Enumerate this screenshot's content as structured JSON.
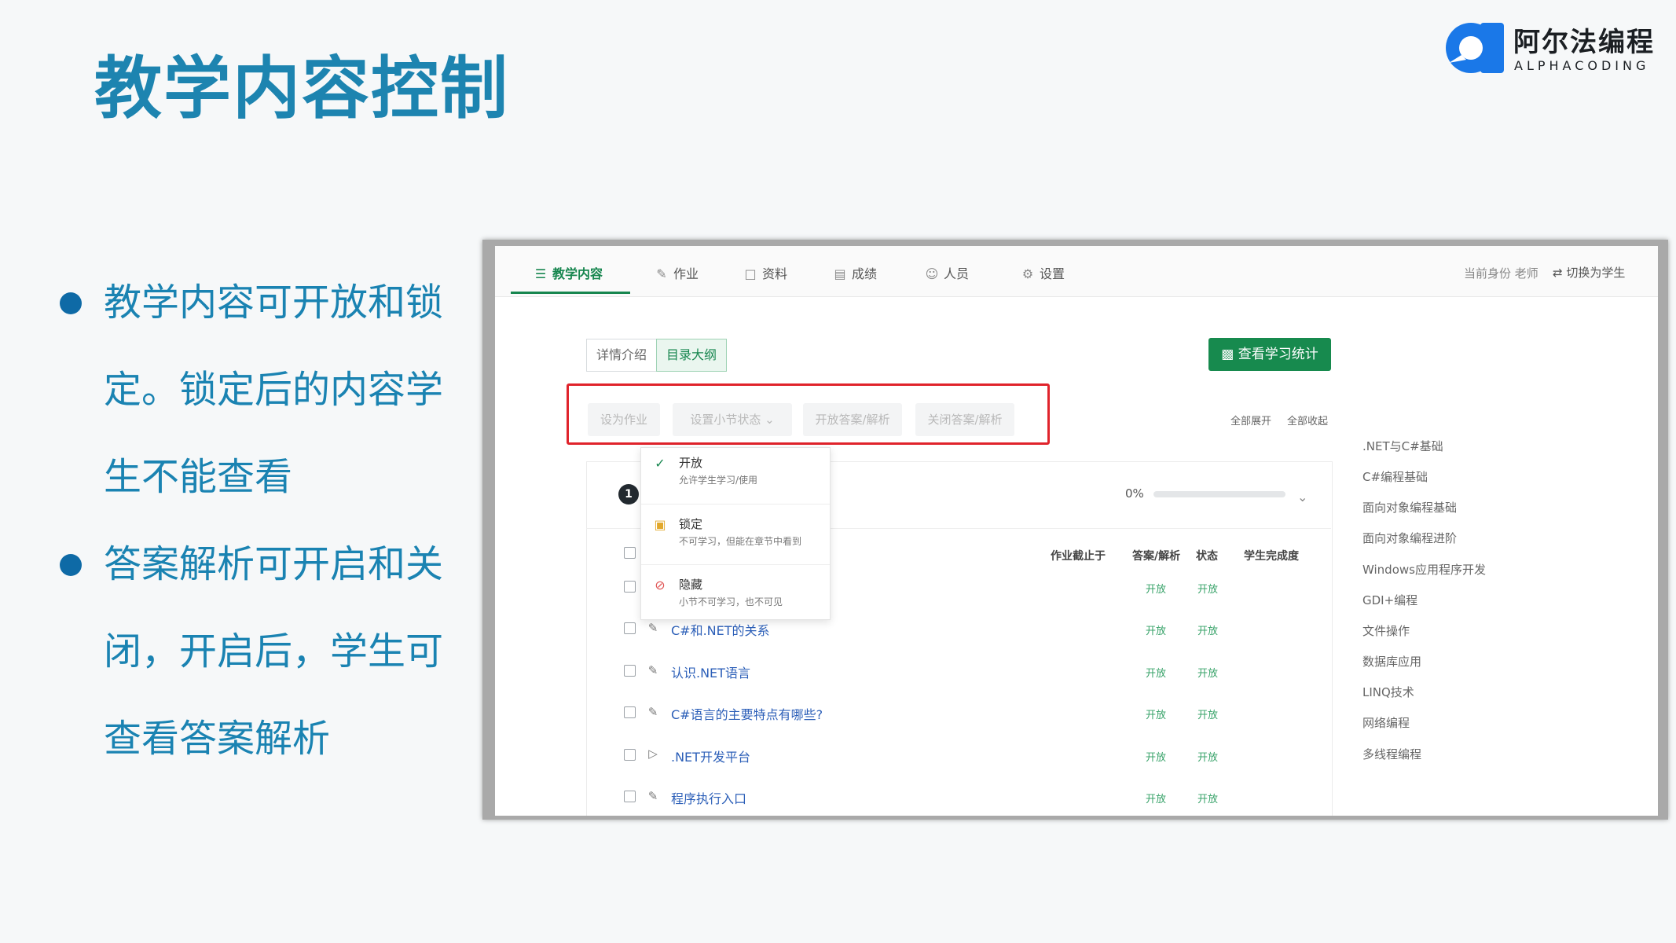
{
  "slide": {
    "title": "教学内容控制",
    "logo": {
      "cn": "阿尔法编程",
      "en": "ALPHACODING"
    },
    "bullets": [
      {
        "lines": [
          "教学内容可开放和锁",
          "定。锁定后的内容学",
          "生不能查看"
        ]
      },
      {
        "lines": [
          "答案解析可开启和关",
          "闭，开启后，学生可",
          "查看答案解析"
        ]
      }
    ]
  },
  "app": {
    "tabs": [
      {
        "label": "教学内容",
        "icon": "book-icon",
        "active": true
      },
      {
        "label": "作业",
        "icon": "pencil-icon"
      },
      {
        "label": "资料",
        "icon": "file-icon"
      },
      {
        "label": "成绩",
        "icon": "score-file-icon"
      },
      {
        "label": "人员",
        "icon": "people-icon"
      },
      {
        "label": "设置",
        "icon": "gear-icon"
      }
    ],
    "identity": "当前身份 老师",
    "switch_label": "切换为学生",
    "segments": [
      "详情介绍",
      "目录大纲"
    ],
    "stats_button": "查看学习统计",
    "toolbar": [
      "设为作业",
      "设置小节状态",
      "开放答案/解析",
      "关闭答案/解析"
    ],
    "expand_all": "全部展开",
    "collapse_all": "全部收起",
    "chapter": {
      "number": "1",
      "progress": "0%"
    },
    "columns": [
      "作业截止于",
      "答案/解析",
      "状态",
      "学生完成度"
    ],
    "rows": [
      {
        "title": "",
        "icon": "",
        "answer": "",
        "status": ""
      },
      {
        "title": "",
        "icon": "",
        "answer": "开放",
        "status": "开放"
      },
      {
        "title": "C#和.NET的关系",
        "icon": "pencil-icon",
        "answer": "开放",
        "status": "开放"
      },
      {
        "title": "认识.NET语言",
        "icon": "pencil-icon",
        "answer": "开放",
        "status": "开放"
      },
      {
        "title": "C#语言的主要特点有哪些?",
        "icon": "pencil-icon",
        "answer": "开放",
        "status": "开放"
      },
      {
        "title": ".NET开发平台",
        "icon": "video-icon",
        "answer": "开放",
        "status": "开放"
      },
      {
        "title": "程序执行入口",
        "icon": "pencil-icon",
        "answer": "开放",
        "status": "开放"
      }
    ],
    "dropdown": [
      {
        "label": "开放",
        "desc": "允许学生学习/使用",
        "icon": "check-icon"
      },
      {
        "label": "锁定",
        "desc": "不可学习，但能在章节中看到",
        "icon": "lock-icon"
      },
      {
        "label": "隐藏",
        "desc": "小节不可学习，也不可见",
        "icon": "eye-off-icon"
      }
    ],
    "sidebar": [
      ".NET与C#基础",
      "C#编程基础",
      "面向对象编程基础",
      "面向对象编程进阶",
      "Windows应用程序开发",
      "GDI+编程",
      "文件操作",
      "数据库应用",
      "LINQ技术",
      "网络编程",
      "多线程编程"
    ],
    "colors": {
      "green": "#178a4e",
      "red_highlight": "#e0232b",
      "title_blue": "#1d84b0"
    }
  }
}
